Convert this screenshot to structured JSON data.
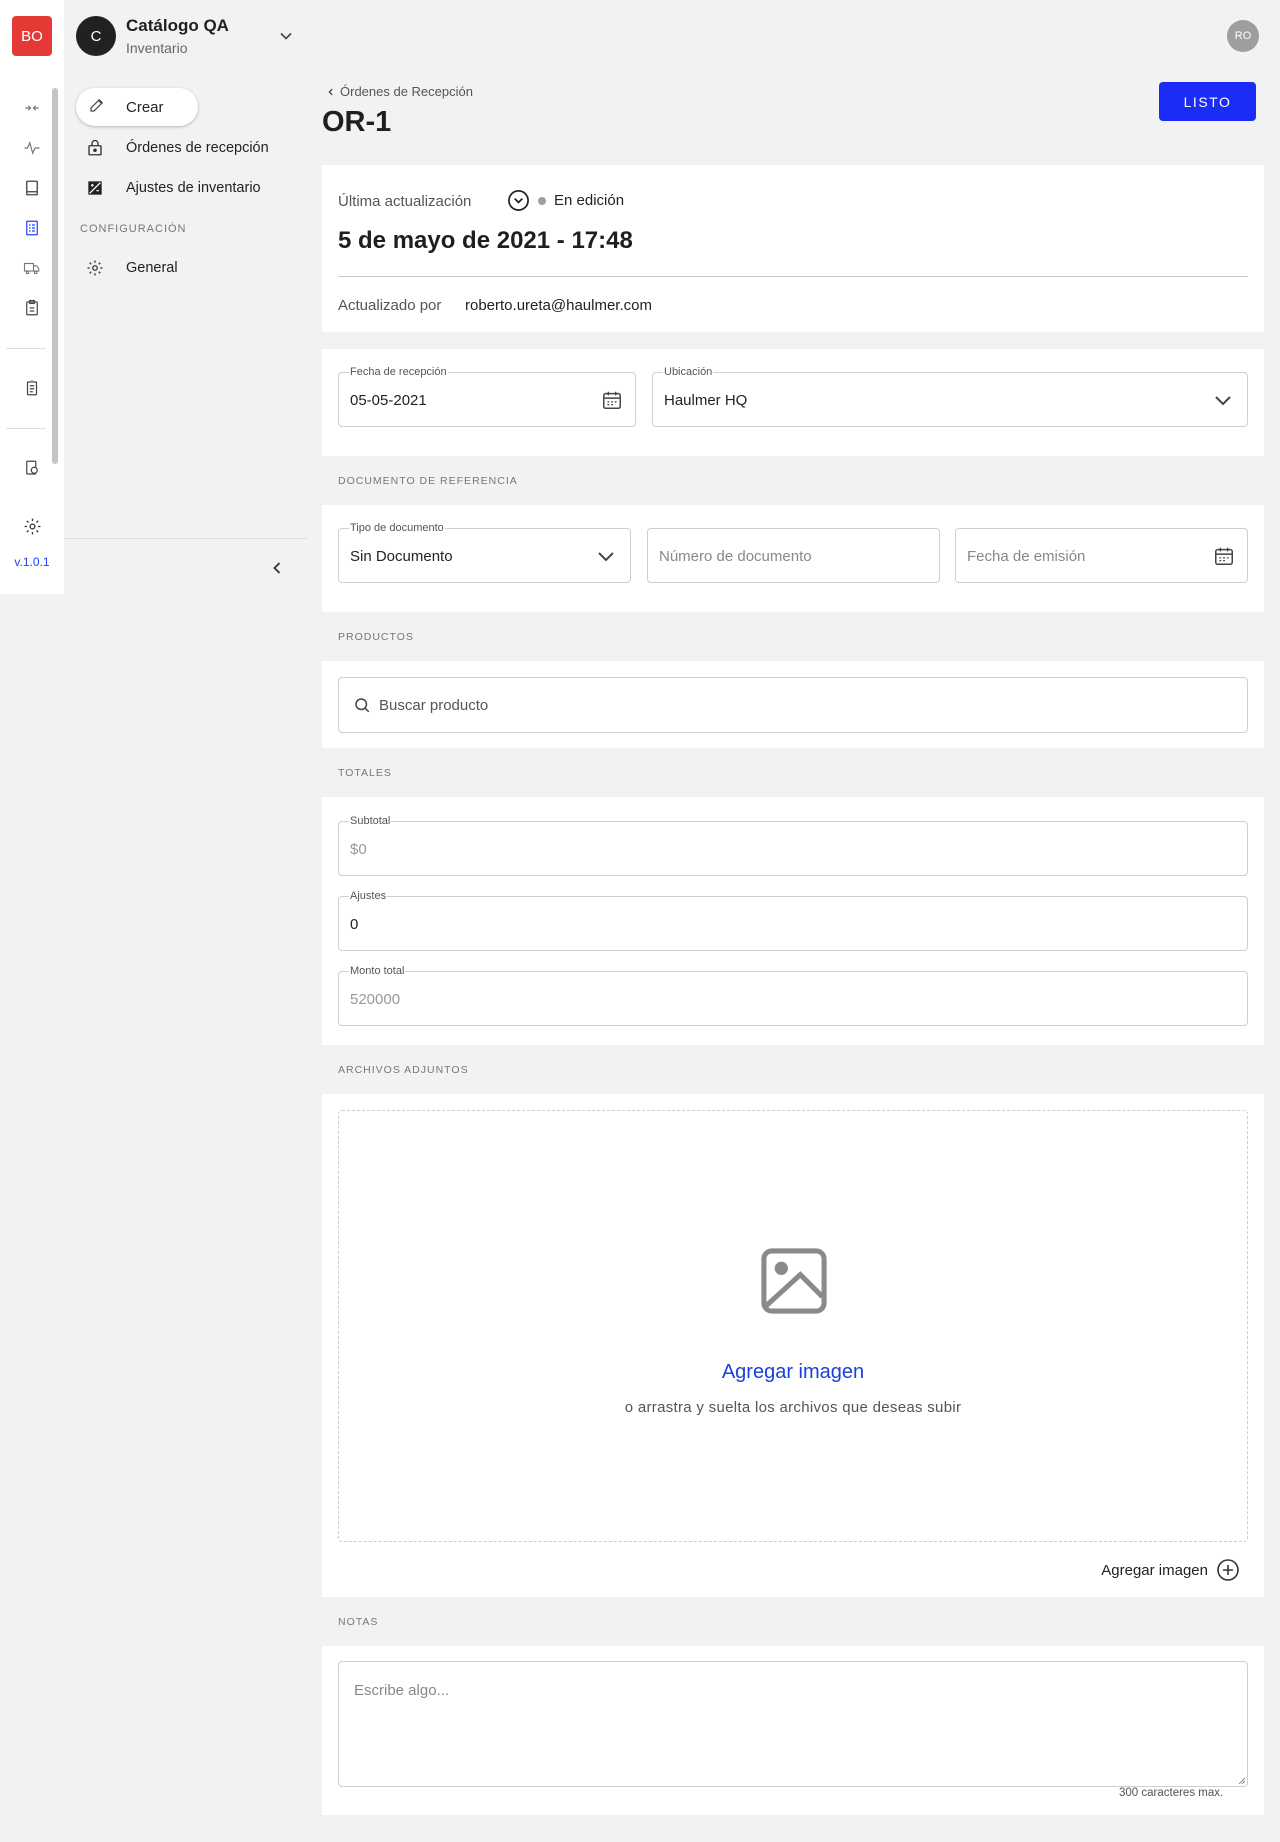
{
  "rail": {
    "logo": "BO",
    "icons": [
      "compare-arrows-icon",
      "activity-icon",
      "book-icon",
      "document-list-icon",
      "truck-icon",
      "clipboard-icon",
      "receipt-icon",
      "coin-document-icon",
      "settings-icon"
    ],
    "version": "v.1.0.1",
    "accent": "#1a40ff"
  },
  "sidebar": {
    "brand_initial": "C",
    "brand_title": "Catálogo QA",
    "brand_subtitle": "Inventario",
    "create_label": "Crear",
    "items": [
      {
        "label": "Órdenes de recepción",
        "icon": "lock-box-icon"
      },
      {
        "label": "Ajustes de inventario",
        "icon": "adjust-icon"
      }
    ],
    "config_section": "CONFIGURACIÓN",
    "config_items": [
      {
        "label": "General",
        "icon": "gear-icon"
      }
    ]
  },
  "header": {
    "avatar_initials": "RO",
    "breadcrumb": "Órdenes de Recepción",
    "title": "OR-1",
    "done_label": "LISTO",
    "done_color": "#1a2cf5"
  },
  "info": {
    "last_updated_label": "Última actualización",
    "status": "En edición",
    "date": "5 de mayo de 2021 - 17:48",
    "updated_by_label": "Actualizado por",
    "updated_by": "roberto.ureta@haulmer.com"
  },
  "reception": {
    "date_label": "Fecha de recepción",
    "date_value": "05-05-2021",
    "location_label": "Ubicación",
    "location_value": "Haulmer HQ"
  },
  "reference": {
    "heading": "DOCUMENTO DE REFERENCIA",
    "doc_type_label": "Tipo de documento",
    "doc_type_value": "Sin Documento",
    "doc_number_placeholder": "Número de documento",
    "issue_date_placeholder": "Fecha de emisión"
  },
  "products": {
    "heading": "PRODUCTOS",
    "search_placeholder": "Buscar producto"
  },
  "totals": {
    "heading": "TOTALES",
    "subtotal_label": "Subtotal",
    "subtotal_value": "$0",
    "adjustments_label": "Ajustes",
    "adjustments_value": "0",
    "total_label": "Monto total",
    "total_value": "520000"
  },
  "attachments": {
    "heading": "ARCHIVOS ADJUNTOS",
    "add_link": "Agregar imagen",
    "hint": "o arrastra y suelta los archivos que deseas subir",
    "add_button": "Agregar imagen"
  },
  "notes": {
    "heading": "NOTAS",
    "placeholder": "Escribe algo...",
    "limit": "300 caracteres max."
  }
}
